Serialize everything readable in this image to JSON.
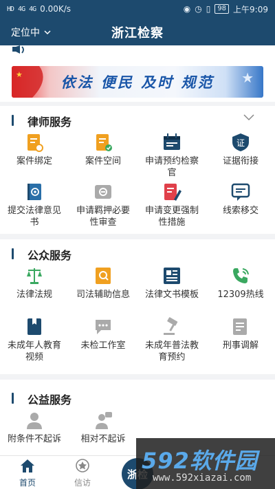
{
  "status": {
    "left": [
      "HD",
      "4G",
      "4G",
      "0.00K/s"
    ],
    "battery": "98",
    "time": "上午9:09"
  },
  "header": {
    "location": "定位中",
    "title": "浙江检察"
  },
  "banner": {
    "text": "依法 便民 及时 规范"
  },
  "lawyer": {
    "title": "律师服务",
    "items": [
      {
        "label": "案件绑定",
        "icon": "case-bind-icon",
        "color": "#f0a020"
      },
      {
        "label": "案件空间",
        "icon": "case-space-icon",
        "color": "#f0a020"
      },
      {
        "label": "申请预约检察官",
        "icon": "calendar-icon",
        "color": "#1d4a6e"
      },
      {
        "label": "证据衔接",
        "icon": "evidence-icon",
        "color": "#1d4a6e"
      },
      {
        "label": "提交法律意见书",
        "icon": "at-book-icon",
        "color": "#2a6fa8"
      },
      {
        "label": "申请羁押必要性审查",
        "icon": "review-icon",
        "color": "#aaaaaa"
      },
      {
        "label": "申请变更强制性措施",
        "icon": "edit-doc-icon",
        "color": "#e0404a"
      },
      {
        "label": "线索移交",
        "icon": "message-icon",
        "color": "#1d4a6e"
      }
    ]
  },
  "public": {
    "title": "公众服务",
    "items": [
      {
        "label": "法律法规",
        "icon": "scales-icon",
        "color": "#3aa860"
      },
      {
        "label": "司法辅助信息",
        "icon": "search-doc-icon",
        "color": "#f0a020"
      },
      {
        "label": "法律文书模板",
        "icon": "template-icon",
        "color": "#1d4a6e"
      },
      {
        "label": "12309热线",
        "icon": "phone-icon",
        "color": "#3aa860"
      },
      {
        "label": "未成年人教育视频",
        "icon": "video-book-icon",
        "color": "#1d4a6e"
      },
      {
        "label": "未检工作室",
        "icon": "chat-icon",
        "color": "#aaaaaa"
      },
      {
        "label": "未成年普法教育预约",
        "icon": "gavel-icon",
        "color": "#aaaaaa"
      },
      {
        "label": "刑事调解",
        "icon": "mediation-icon",
        "color": "#aaaaaa"
      }
    ]
  },
  "welfare": {
    "title": "公益服务",
    "items": [
      {
        "label": "附条件不起诉",
        "icon": "person-icon",
        "color": "#aaaaaa"
      },
      {
        "label": "相对不起诉",
        "icon": "person-chat-icon",
        "color": "#aaaaaa"
      }
    ]
  },
  "tabs": [
    {
      "label": "首页",
      "icon": "home-icon",
      "active": true
    },
    {
      "label": "信访",
      "icon": "badge-icon",
      "active": false
    }
  ],
  "center_button": {
    "label": "浙检"
  },
  "watermark": {
    "brand": "592软件园",
    "url": "www.592xiazai.com"
  }
}
